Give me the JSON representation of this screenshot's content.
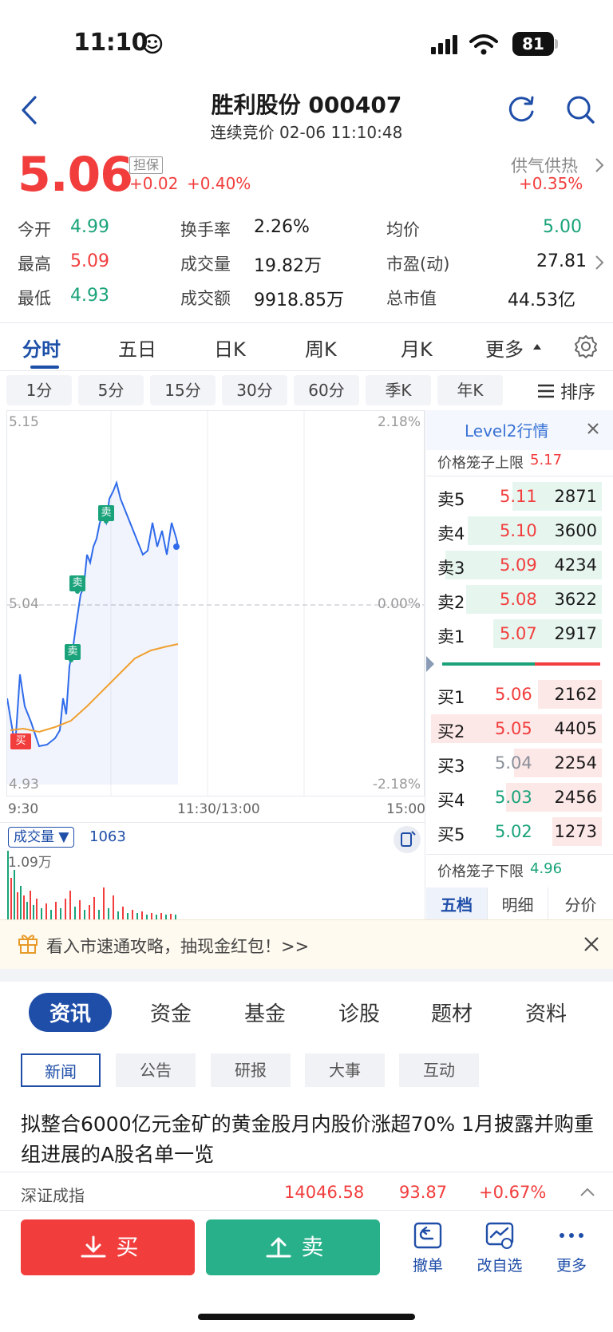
{
  "status": {
    "time": "11:10",
    "battery": "81"
  },
  "header": {
    "title": "胜利股份 000407",
    "subtitle": "连续竞价 02-06 11:10:48"
  },
  "quote": {
    "price": "5.06",
    "tag": "担保",
    "change": "+0.02",
    "change_pct": "+0.40%",
    "sector": "供气供热",
    "sector_pct": "+0.35%"
  },
  "stats": [
    {
      "label": "今开",
      "value": "4.99"
    },
    {
      "label": "最高",
      "value": "5.09"
    },
    {
      "label": "最低",
      "value": "4.93"
    },
    {
      "label": "换手率",
      "value": "2.26%"
    },
    {
      "label": "成交量",
      "value": "19.82万"
    },
    {
      "label": "成交额",
      "value": "9918.85万"
    },
    {
      "label": "均价",
      "value": "5.00"
    },
    {
      "label": "市盈(动)",
      "value": "27.81"
    },
    {
      "label": "总市值",
      "value": "44.53亿"
    }
  ],
  "chart_tabs": [
    "分时",
    "五日",
    "日K",
    "周K",
    "月K",
    "更多"
  ],
  "period_tabs": [
    "1分",
    "5分",
    "15分",
    "30分",
    "60分",
    "季K",
    "年K"
  ],
  "sort_label": "排序",
  "chart_axes": {
    "y_top": "5.15",
    "y_mid": "5.04",
    "y_bot": "4.93",
    "pct_top": "2.18%",
    "pct_mid": "0.00%",
    "pct_bot": "-2.18%",
    "x_start": "9:30",
    "x_mid": "11:30/13:00",
    "x_end": "15:00",
    "sell_marker": "卖",
    "buy_marker": "买"
  },
  "volume": {
    "label": "成交量",
    "value": "1063",
    "max": "1.09万"
  },
  "level2": {
    "title": "Level2行情",
    "upper_limit_label": "价格笼子上限",
    "upper_limit": "5.17",
    "lower_limit_label": "价格笼子下限",
    "lower_limit": "4.96",
    "asks": [
      {
        "label": "卖5",
        "price": "5.11",
        "vol": "2871"
      },
      {
        "label": "卖4",
        "price": "5.10",
        "vol": "3600"
      },
      {
        "label": "卖3",
        "price": "5.09",
        "vol": "4234"
      },
      {
        "label": "卖2",
        "price": "5.08",
        "vol": "3622"
      },
      {
        "label": "卖1",
        "price": "5.07",
        "vol": "2917"
      }
    ],
    "bids": [
      {
        "label": "买1",
        "price": "5.06",
        "vol": "2162"
      },
      {
        "label": "买2",
        "price": "5.05",
        "vol": "4405"
      },
      {
        "label": "买3",
        "price": "5.04",
        "vol": "2254"
      },
      {
        "label": "买4",
        "price": "5.03",
        "vol": "2456"
      },
      {
        "label": "买5",
        "price": "5.02",
        "vol": "1273"
      }
    ],
    "bottom_tabs": [
      "五档",
      "明细",
      "分价"
    ]
  },
  "promo": {
    "text": "看入市速通攻略，抽现金红包！>>"
  },
  "research_tabs": [
    "资讯",
    "资金",
    "基金",
    "诊股",
    "题材",
    "资料"
  ],
  "sub_tabs": [
    "新闻",
    "公告",
    "研报",
    "大事",
    "互动"
  ],
  "news": {
    "headline": "拟整合6000亿元金矿的黄金股月内股价涨超70% 1月披露并购重组进展的A股名单一览"
  },
  "index": {
    "name": "深证成指",
    "value": "14046.58",
    "change": "93.87",
    "change_pct": "+0.67%"
  },
  "actions": {
    "buy": "买",
    "sell": "卖",
    "cancel": "撤单",
    "watchlist": "改自选",
    "more": "更多"
  }
}
